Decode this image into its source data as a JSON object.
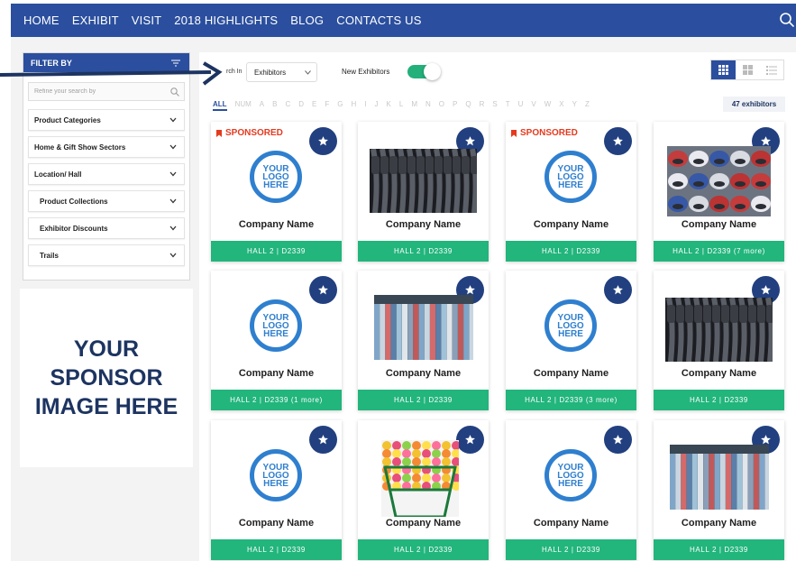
{
  "nav": {
    "items": [
      "HOME",
      "EXHIBIT",
      "VISIT",
      "2018 HIGHLIGHTS",
      "BLOG",
      "CONTACTS US"
    ]
  },
  "sidebar": {
    "header": "FILTER BY",
    "search_placeholder": "Refine your search by",
    "facets": [
      {
        "label": "Product Categories"
      },
      {
        "label": "Home & Gift Show Sectors"
      },
      {
        "label": "Location/ Hall"
      },
      {
        "label": "Product Collections"
      },
      {
        "label": "Exhibitor Discounts"
      },
      {
        "label": "Trails"
      }
    ]
  },
  "sponsor": {
    "text": "YOUR SPONSOR IMAGE HERE"
  },
  "toolbar": {
    "search_in_label": "rch In",
    "search_in_value": "Exhibitors",
    "new_exhibitors_label": "New Exhibitors",
    "new_exhibitors_on": true
  },
  "alphabet": [
    "ALL",
    "NUM",
    "A",
    "B",
    "C",
    "D",
    "E",
    "F",
    "G",
    "H",
    "I",
    "J",
    "K",
    "L",
    "M",
    "N",
    "O",
    "P",
    "Q",
    "R",
    "S",
    "T",
    "U",
    "V",
    "W",
    "X",
    "Y",
    "Z"
  ],
  "exhibitor_count": "47 exhibitors",
  "logo_text": [
    "YOUR",
    "LOGO",
    "HERE"
  ],
  "cards": [
    {
      "name": "Company Name",
      "hall": "HALL 2 | D2339",
      "sponsored": "SPONSORED",
      "image": "logo"
    },
    {
      "name": "Company Name",
      "hall": "HALL 2 | D2339",
      "sponsored": "",
      "image": "dark-rack-photo"
    },
    {
      "name": "Company Name",
      "hall": "HALL 2 | D2339",
      "sponsored": "SPONSORED",
      "image": "logo"
    },
    {
      "name": "Company Name",
      "hall": "HALL 2 | D2339 (7 more)",
      "sponsored": "",
      "image": "shoes-photo"
    },
    {
      "name": "Company Name",
      "hall": "HALL 2 | D2339 (1 more)",
      "sponsored": "",
      "image": "logo"
    },
    {
      "name": "Company Name",
      "hall": "HALL 2 | D2339",
      "sponsored": "",
      "image": "shirts-photo"
    },
    {
      "name": "Company Name",
      "hall": "HALL 2 | D2339 (3 more)",
      "sponsored": "",
      "image": "logo"
    },
    {
      "name": "Company Name",
      "hall": "HALL 2 | D2339",
      "sponsored": "",
      "image": "dark-rack-photo"
    },
    {
      "name": "Company Name",
      "hall": "HALL 2 | D2339",
      "sponsored": "",
      "image": "logo"
    },
    {
      "name": "Company Name",
      "hall": "HALL 2 | D2339",
      "sponsored": "",
      "image": "golf-balls-photo"
    },
    {
      "name": "Company Name",
      "hall": "HALL 2 | D2339",
      "sponsored": "",
      "image": "logo"
    },
    {
      "name": "Company Name",
      "hall": "HALL 2 | D2339",
      "sponsored": "",
      "image": "shirts-photo"
    }
  ],
  "colors": {
    "brand_blue": "#2b4f9e",
    "navy": "#1d3461",
    "green": "#22b57c",
    "sponsored_red": "#e53a1e",
    "logo_blue": "#2f7fcf"
  }
}
